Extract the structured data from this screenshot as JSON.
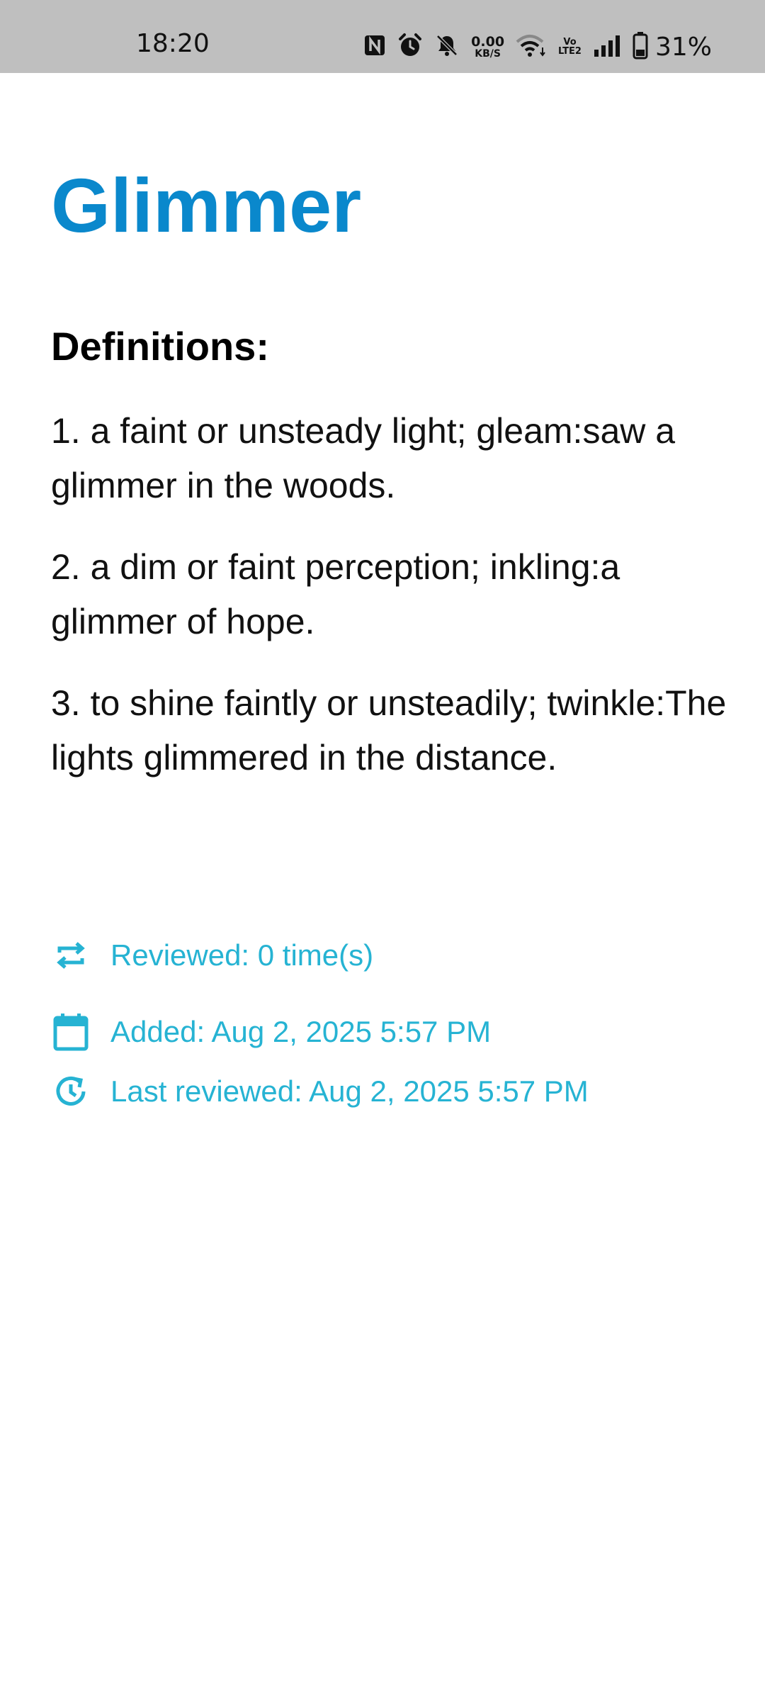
{
  "status_bar": {
    "time": "18:20",
    "net_speed_value": "0.00",
    "net_speed_unit": "KB/S",
    "volte_top": "Vo",
    "volte_bottom": "LTE2",
    "battery_percent": "31%"
  },
  "word": {
    "title": "Glimmer",
    "definitions_heading": "Definitions:",
    "definitions": [
      "1. a faint or unsteady light; gleam:saw a glimmer in the woods.",
      "2. a dim or faint perception; inkling:a glimmer of hope.",
      "3. to shine faintly or unsteadily; twinkle:The lights glimmered in the distance."
    ]
  },
  "meta": {
    "reviewed": "Reviewed: 0 time(s)",
    "added": "Added: Aug 2, 2025 5:57 PM",
    "last_reviewed": "Last reviewed: Aug 2, 2025 5:57 PM",
    "accent_color": "#26b3d3"
  },
  "colors": {
    "title": "#0a88cc",
    "status_bar_bg": "#bfbfbf"
  }
}
